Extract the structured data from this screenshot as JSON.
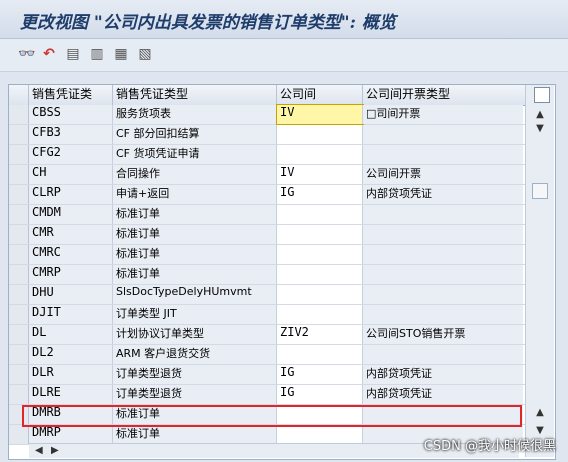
{
  "window": {
    "title": "更改视图 \"公司内出具发票的销售订单类型\": 概览"
  },
  "toolbar": {
    "icons": [
      "glasses-icon",
      "undo-icon",
      "doc-icon",
      "doc-icon",
      "doc-icon",
      "doc-icon"
    ]
  },
  "table": {
    "columns": [
      "销售凭证类",
      "销售凭证类型",
      "公司间",
      "公司间开票类型"
    ],
    "rows": [
      {
        "code": "CBSS",
        "desc": "服务货项表",
        "ic": "IV",
        "ictype": "□司间开票"
      },
      {
        "code": "CFB3",
        "desc": "CF 部分回扣结算",
        "ic": "",
        "ictype": ""
      },
      {
        "code": "CFG2",
        "desc": "CF 货项凭证申请",
        "ic": "",
        "ictype": ""
      },
      {
        "code": "CH",
        "desc": "合同操作",
        "ic": "IV",
        "ictype": "公司间开票"
      },
      {
        "code": "CLRP",
        "desc": "申请+返回",
        "ic": "IG",
        "ictype": "内部贷项凭证"
      },
      {
        "code": "CMDM",
        "desc": "标准订单",
        "ic": "",
        "ictype": ""
      },
      {
        "code": "CMR",
        "desc": "标准订单",
        "ic": "",
        "ictype": ""
      },
      {
        "code": "CMRC",
        "desc": "标准订单",
        "ic": "",
        "ictype": ""
      },
      {
        "code": "CMRP",
        "desc": "标准订单",
        "ic": "",
        "ictype": ""
      },
      {
        "code": "DHU",
        "desc": "SlsDocTypeDelyHUmvmt",
        "ic": "",
        "ictype": ""
      },
      {
        "code": "DJIT",
        "desc": "订单类型 JIT",
        "ic": "",
        "ictype": ""
      },
      {
        "code": "DL",
        "desc": "计划协议订单类型",
        "ic": "ZIV2",
        "ictype": "公司间STO销售开票"
      },
      {
        "code": "DL2",
        "desc": "ARM 客户退货交货",
        "ic": "",
        "ictype": ""
      },
      {
        "code": "DLR",
        "desc": "订单类型退货",
        "ic": "IG",
        "ictype": "内部贷项凭证"
      },
      {
        "code": "DLRE",
        "desc": "订单类型退货",
        "ic": "IG",
        "ictype": "内部贷项凭证"
      },
      {
        "code": "DMRB",
        "desc": "标准订单",
        "ic": "",
        "ictype": ""
      },
      {
        "code": "DMRP",
        "desc": "标准订单",
        "ic": "",
        "ictype": ""
      }
    ]
  },
  "watermark": "CSDN @我小时候很黑"
}
